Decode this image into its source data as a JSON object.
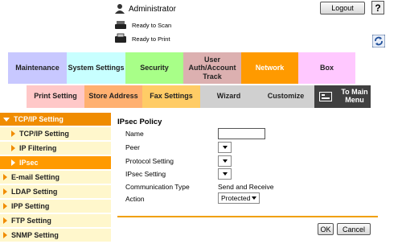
{
  "header": {
    "user": "Administrator",
    "logout_label": "Logout",
    "help_label": "?",
    "scan_status": "Ready to Scan",
    "print_status": "Ready to Print"
  },
  "main_tabs": [
    {
      "label": "Maintenance",
      "color": "#c8c8ff"
    },
    {
      "label": "System Settings",
      "color": "#c8ffff"
    },
    {
      "label": "Security",
      "color": "#a8ff88"
    },
    {
      "label": "User Auth/Account Track",
      "color": "#dcb0b0"
    },
    {
      "label": "Network",
      "color": "#ff9a00"
    },
    {
      "label": "Box",
      "color": "#ffc8ff"
    }
  ],
  "sub_tabs": [
    {
      "label": "Print Setting",
      "color": "#ffc8c8"
    },
    {
      "label": "Store Address",
      "color": "#ffb070"
    },
    {
      "label": "Fax Settings",
      "color": "#ffcc66"
    },
    {
      "label": "Wizard",
      "color": "#d0d0d0"
    },
    {
      "label": "Customize",
      "color": "#d0d0d0"
    },
    {
      "label": "To Main Menu",
      "color": "#404040"
    }
  ],
  "sidebar": {
    "items": [
      {
        "label": "TCP/IP Setting"
      },
      {
        "label": "TCP/IP Setting"
      },
      {
        "label": "IP Filtering"
      },
      {
        "label": "IPsec"
      },
      {
        "label": "E-mail Setting"
      },
      {
        "label": "LDAP Setting"
      },
      {
        "label": "IPP Setting"
      },
      {
        "label": "FTP Setting"
      },
      {
        "label": "SNMP Setting"
      }
    ]
  },
  "form": {
    "title": "IPsec Policy",
    "name_label": "Name",
    "name_value": "",
    "peer_label": "Peer",
    "protocol_label": "Protocol Setting",
    "ipsec_label": "IPsec Setting",
    "comm_type_label": "Communication Type",
    "comm_type_value": "Send and Receive",
    "action_label": "Action",
    "action_value": "Protected",
    "ok_label": "OK",
    "cancel_label": "Cancel"
  },
  "colors": {
    "accent": "#f08c00",
    "sidebar_bg": "#fff7cc",
    "active": "#ff9a00"
  }
}
